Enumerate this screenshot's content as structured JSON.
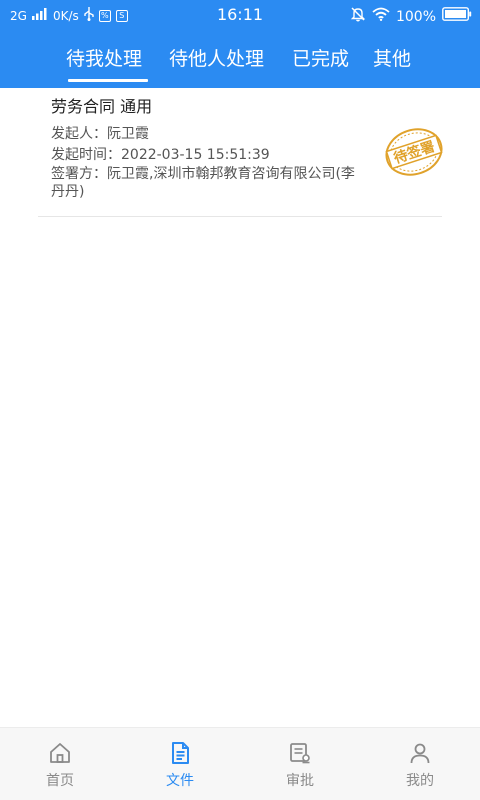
{
  "status_bar": {
    "network": "2G",
    "speed": "0K/s",
    "time": "16:11",
    "battery": "100%",
    "icons": [
      "signal-bars-icon",
      "usb-icon",
      "app-icon",
      "s-box-icon",
      "mute-bell-icon",
      "wifi-icon",
      "battery-icon"
    ]
  },
  "tabs": [
    {
      "label": "待我处理",
      "active": true
    },
    {
      "label": "待他人处理",
      "active": false
    },
    {
      "label": "已完成",
      "active": false
    },
    {
      "label": "其他",
      "active": false
    }
  ],
  "document": {
    "title": "劳务合同 通用",
    "initiator": "发起人：阮卫霞",
    "time": "发起时间：2022-03-15 15:51:39",
    "signers": "签署方：阮卫霞,深圳市翰邦教育咨询有限公司(李丹丹)",
    "stamp_text": "待签署"
  },
  "bottom_nav": [
    {
      "label": "首页",
      "icon": "home-icon",
      "active": false
    },
    {
      "label": "文件",
      "icon": "file-icon",
      "active": true
    },
    {
      "label": "审批",
      "icon": "approval-icon",
      "active": false
    },
    {
      "label": "我的",
      "icon": "user-icon",
      "active": false
    }
  ],
  "colors": {
    "primary": "#2b8bf2",
    "stamp": "#e0a22b",
    "nav_inactive": "#8a8a8a"
  }
}
